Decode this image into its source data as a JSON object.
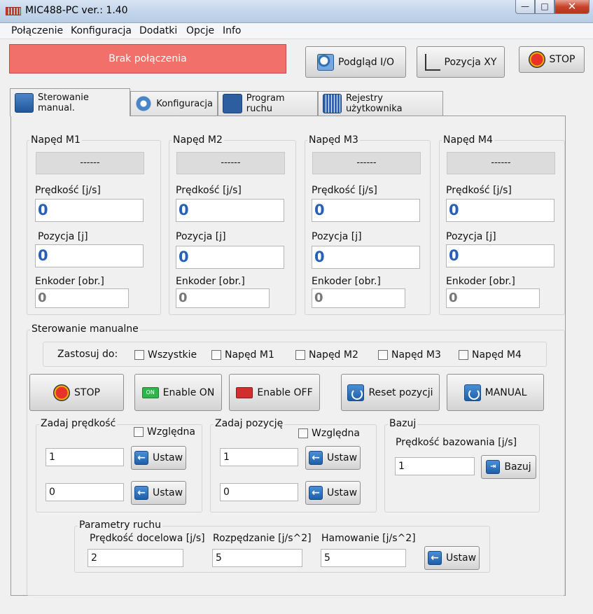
{
  "window": {
    "title": "MIC488-PC  ver.: 1.40"
  },
  "menu": [
    "Połączenie",
    "Konfiguracja",
    "Dodatki",
    "Opcje",
    "Info"
  ],
  "status": {
    "connection": "Brak połączenia",
    "color": "#f1706a"
  },
  "toolbar": {
    "io_label": "Podgląd I/O",
    "xy_label": "Pozycja XY",
    "stop_label": "STOP"
  },
  "tabs": [
    "Sterowanie manual.",
    "Konfiguracja",
    "Program ruchu",
    "Rejestry użytkownika"
  ],
  "drives": [
    {
      "title": "Napęd M1",
      "readout": "------",
      "speed_label": "Prędkość [j/s]",
      "speed": "0",
      "pos_label": "Pozycja [j]",
      "pos": "0",
      "enc_label": "Enkoder [obr.]",
      "enc": "0"
    },
    {
      "title": "Napęd M2",
      "readout": "------",
      "speed_label": "Prędkość [j/s]",
      "speed": "0",
      "pos_label": "Pozycja [j]",
      "pos": "0",
      "enc_label": "Enkoder [obr.]",
      "enc": "0"
    },
    {
      "title": "Napęd M3",
      "readout": "------",
      "speed_label": "Prędkość [j/s]",
      "speed": "0",
      "pos_label": "Pozycja [j]",
      "pos": "0",
      "enc_label": "Enkoder [obr.]",
      "enc": "0"
    },
    {
      "title": "Napęd M4",
      "readout": "------",
      "speed_label": "Prędkość [j/s]",
      "speed": "0",
      "pos_label": "Pozycja [j]",
      "pos": "0",
      "enc_label": "Enkoder [obr.]",
      "enc": "0"
    }
  ],
  "manual": {
    "title": "Sterowanie manualne",
    "apply_label": "Zastosuj do:",
    "targets": [
      "Wszystkie",
      "Napęd M1",
      "Napęd M2",
      "Napęd M3",
      "Napęd M4"
    ],
    "buttons": {
      "stop": "STOP",
      "enable_on": "Enable ON",
      "on_icon_text": "ON",
      "enable_off": "Enable OFF",
      "reset": "Reset pozycji",
      "manual": "MANUAL"
    },
    "speed_set": {
      "title": "Zadaj prędkość",
      "relative": "Względna",
      "value1": "1",
      "value2": "0",
      "button": "Ustaw"
    },
    "pos_set": {
      "title": "Zadaj pozycję",
      "relative": "Względna",
      "value1": "1",
      "value2": "0",
      "button": "Ustaw"
    },
    "homing": {
      "title": "Bazuj",
      "speed_label": "Prędkość bazowania  [j/s]",
      "speed_value": "1",
      "button": "Bazuj"
    },
    "motion": {
      "title": "Parametry ruchu",
      "target_speed_label": "Prędkość docelowa [j/s]",
      "target_speed": "2",
      "accel_label": "Rozpędzanie [j/s^2]",
      "accel": "5",
      "decel_label": "Hamowanie [j/s^2]",
      "decel": "5",
      "button": "Ustaw"
    }
  }
}
